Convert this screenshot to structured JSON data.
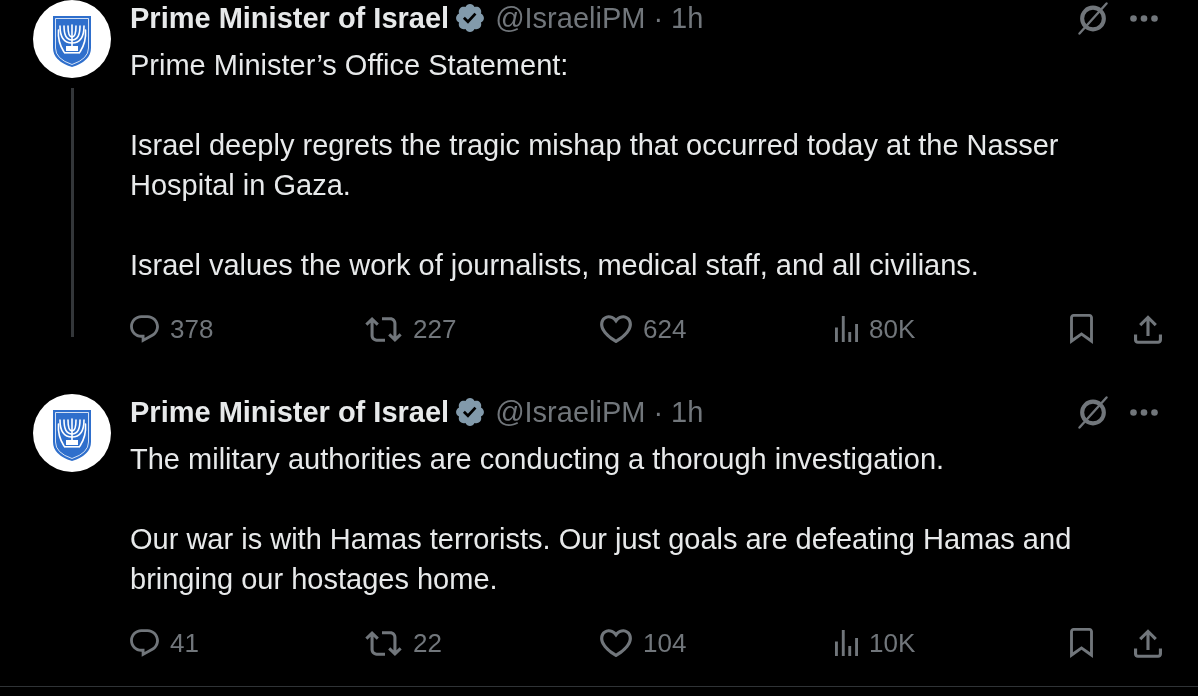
{
  "tweets": [
    {
      "author": {
        "name": "Prime Minister of Israel",
        "verified": true,
        "handle": "@IsraeliPM",
        "separator": "·",
        "time": "1h"
      },
      "thread_continues": true,
      "paragraphs": [
        "Prime Minister’s Office Statement:",
        "Israel deeply regrets the tragic mishap that occurred today at the Nasser Hospital in Gaza.",
        "Israel values the work of journalists, medical staff, and all civilians."
      ],
      "actions": [
        {
          "kind": "reply",
          "count": "378"
        },
        {
          "kind": "repost",
          "count": "227"
        },
        {
          "kind": "like",
          "count": "624"
        },
        {
          "kind": "views",
          "count": "80K"
        },
        {
          "kind": "bookmark"
        },
        {
          "kind": "share"
        }
      ]
    },
    {
      "author": {
        "name": "Prime Minister of Israel",
        "verified": true,
        "handle": "@IsraeliPM",
        "separator": "·",
        "time": "1h"
      },
      "thread_continues": false,
      "paragraphs": [
        "The military authorities are conducting a thorough investigation.",
        "Our war is with Hamas terrorists. Our just goals are defeating Hamas and bringing our hostages home."
      ],
      "actions": [
        {
          "kind": "reply",
          "count": "41"
        },
        {
          "kind": "repost",
          "count": "22"
        },
        {
          "kind": "like",
          "count": "104"
        },
        {
          "kind": "views",
          "count": "10K"
        },
        {
          "kind": "bookmark"
        },
        {
          "kind": "share"
        }
      ]
    }
  ]
}
